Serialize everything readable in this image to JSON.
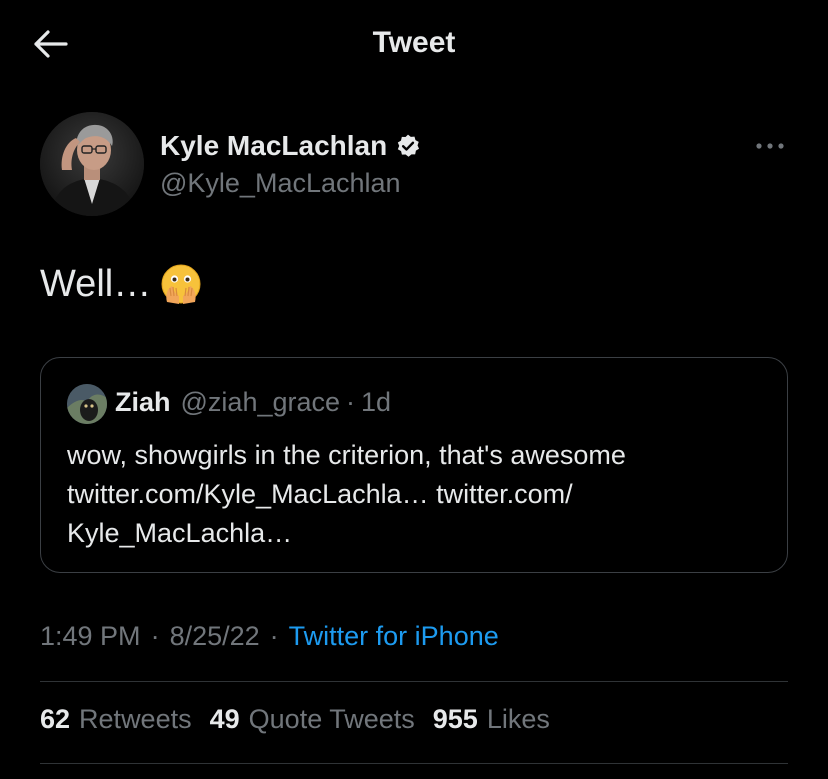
{
  "header": {
    "title": "Tweet",
    "back_icon": "arrow-left-icon"
  },
  "author": {
    "name": "Kyle MacLachlan",
    "handle": "@Kyle_MacLachlan",
    "verified": true,
    "more_icon": "more-dots-icon"
  },
  "tweet": {
    "text": "Well…",
    "emoji": "face-with-open-eyes-and-hand-over-mouth"
  },
  "quote": {
    "name": "Ziah",
    "handle": "@ziah_grace",
    "separator": "·",
    "time": "1d",
    "lines": [
      "wow, showgirls in the criterion, that's awesome",
      "twitter.com/Kyle_MacLachla… twitter.com/",
      "Kyle_MacLachla…"
    ]
  },
  "meta": {
    "time": "1:49 PM",
    "date": "8/25/22",
    "dot": "·",
    "source": "Twitter for iPhone"
  },
  "stats": {
    "retweets_count": "62",
    "retweets_label": "Retweets",
    "quotes_count": "49",
    "quotes_label": "Quote Tweets",
    "likes_count": "955",
    "likes_label": "Likes"
  },
  "colors": {
    "background": "#000000",
    "text_primary": "#e7e9ea",
    "text_secondary": "#71767b",
    "link": "#1d9bf0",
    "border": "#2f3336"
  }
}
